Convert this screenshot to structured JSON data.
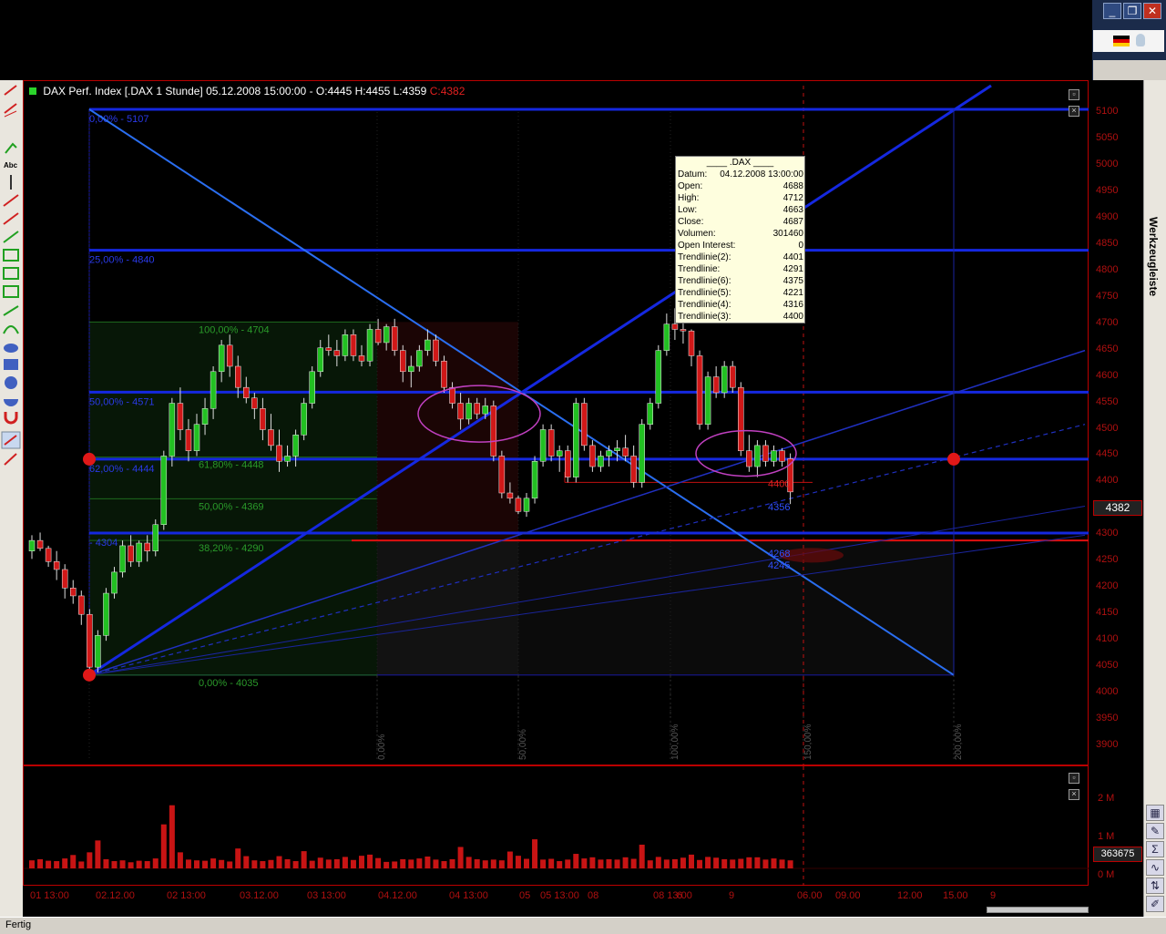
{
  "chart": {
    "instrument": "DAX Perf. Index [.DAX  1 Stunde]",
    "date": "05.12.2008 15:00:00",
    "ohlc_text": "- O:4445 H:4455 L:4359",
    "close_text": "C:4382",
    "last_price": "4382",
    "volume_tag": "363675"
  },
  "tooltip": {
    "header": "____ .DAX ____",
    "rows": [
      {
        "label": "Datum:",
        "value": "04.12.2008 13:00:00"
      },
      {
        "label": "Open:",
        "value": "4688"
      },
      {
        "label": "High:",
        "value": "4712"
      },
      {
        "label": "Low:",
        "value": "4663"
      },
      {
        "label": "Close:",
        "value": "4687"
      },
      {
        "label": "Volumen:",
        "value": "301460"
      },
      {
        "label": "Open Interest:",
        "value": "0"
      },
      {
        "label": "Trendlinie(2):",
        "value": "4401"
      },
      {
        "label": "Trendlinie:",
        "value": "4291"
      },
      {
        "label": "Trendlinie(6):",
        "value": "4375"
      },
      {
        "label": "Trendlinie(5):",
        "value": "4221"
      },
      {
        "label": "Trendlinie(4):",
        "value": "4316"
      },
      {
        "label": "Trendlinie(3):",
        "value": "4400"
      }
    ]
  },
  "fib_blue": [
    {
      "text": "0,00% - 5107",
      "price": 5107
    },
    {
      "text": "25,00% - 4840",
      "price": 4840
    },
    {
      "text": "50,00% - 4571",
      "price": 4571
    },
    {
      "text": "62,00% - 4444",
      "price": 4444
    },
    {
      "text": "- 4304",
      "price": 4304
    }
  ],
  "fib_green": [
    {
      "text": "100,00% - 4704",
      "price": 4704
    },
    {
      "text": "61,80% - 4448",
      "price": 4448
    },
    {
      "text": "50,00% - 4369",
      "price": 4369
    },
    {
      "text": "38,20% - 4290",
      "price": 4290
    },
    {
      "text": "0,00% - 4035",
      "price": 4035
    }
  ],
  "level_labels": [
    {
      "text": "4400",
      "price": 4400,
      "color": "#e02020"
    },
    {
      "text": "4356",
      "price": 4356,
      "color": "#3050ff"
    },
    {
      "text": "4268",
      "price": 4268,
      "color": "#3050ff"
    },
    {
      "text": "4245",
      "price": 4245,
      "color": "#3050ff"
    }
  ],
  "time_pct_labels": [
    "0,00%",
    "50,00%",
    "100,00%",
    "150,00%",
    "200,00%"
  ],
  "y_ticks": [
    "5100",
    "5050",
    "5000",
    "4950",
    "4900",
    "4850",
    "4800",
    "4750",
    "4700",
    "4650",
    "4600",
    "4550",
    "4500",
    "4450",
    "4400",
    "4350",
    "4300",
    "4250",
    "4200",
    "4150",
    "4100",
    "4050",
    "4000",
    "3950",
    "3900"
  ],
  "vol_ticks": [
    "2 M",
    "1 M",
    "0 M"
  ],
  "x_ticks": [
    "01 13:00",
    "02.12.00",
    "02 13:00",
    "03.12.00",
    "03 13:00",
    "04.12.00",
    "04 13:00",
    "05",
    "05 13:00",
    "08",
    "08 13:00",
    "6",
    "9",
    "06.00",
    "09.00",
    "12.00",
    "15.00",
    "9"
  ],
  "status": "Fertig",
  "sidebar_label": "Werkzeugleiste",
  "chart_data": {
    "type": "candlestick",
    "ylim": [
      3880,
      5130
    ],
    "candles": [
      [
        4270,
        4300,
        4255,
        4290
      ],
      [
        4290,
        4305,
        4270,
        4275
      ],
      [
        4275,
        4280,
        4240,
        4250
      ],
      [
        4250,
        4270,
        4215,
        4235
      ],
      [
        4235,
        4245,
        4180,
        4200
      ],
      [
        4200,
        4215,
        4170,
        4185
      ],
      [
        4185,
        4195,
        4130,
        4150
      ],
      [
        4150,
        4160,
        4040,
        4050
      ],
      [
        4050,
        4120,
        4040,
        4110
      ],
      [
        4110,
        4200,
        4100,
        4190
      ],
      [
        4190,
        4240,
        4180,
        4230
      ],
      [
        4230,
        4290,
        4220,
        4280
      ],
      [
        4280,
        4300,
        4240,
        4250
      ],
      [
        4250,
        4290,
        4240,
        4285
      ],
      [
        4285,
        4300,
        4250,
        4270
      ],
      [
        4270,
        4330,
        4260,
        4320
      ],
      [
        4320,
        4460,
        4310,
        4450
      ],
      [
        4450,
        4560,
        4430,
        4550
      ],
      [
        4550,
        4580,
        4480,
        4500
      ],
      [
        4500,
        4520,
        4440,
        4460
      ],
      [
        4460,
        4530,
        4450,
        4510
      ],
      [
        4510,
        4560,
        4490,
        4540
      ],
      [
        4540,
        4620,
        4520,
        4610
      ],
      [
        4610,
        4670,
        4590,
        4660
      ],
      [
        4660,
        4680,
        4600,
        4620
      ],
      [
        4620,
        4640,
        4560,
        4580
      ],
      [
        4580,
        4600,
        4550,
        4560
      ],
      [
        4560,
        4570,
        4520,
        4540
      ],
      [
        4540,
        4560,
        4480,
        4500
      ],
      [
        4500,
        4530,
        4460,
        4470
      ],
      [
        4470,
        4500,
        4420,
        4440
      ],
      [
        4440,
        4470,
        4430,
        4450
      ],
      [
        4450,
        4500,
        4430,
        4490
      ],
      [
        4490,
        4560,
        4480,
        4550
      ],
      [
        4550,
        4620,
        4540,
        4610
      ],
      [
        4610,
        4670,
        4600,
        4655
      ],
      [
        4655,
        4680,
        4640,
        4650
      ],
      [
        4650,
        4670,
        4620,
        4640
      ],
      [
        4640,
        4690,
        4630,
        4680
      ],
      [
        4680,
        4690,
        4630,
        4640
      ],
      [
        4640,
        4660,
        4620,
        4630
      ],
      [
        4630,
        4700,
        4620,
        4690
      ],
      [
        4690,
        4710,
        4660,
        4665
      ],
      [
        4665,
        4700,
        4650,
        4695
      ],
      [
        4695,
        4710,
        4640,
        4650
      ],
      [
        4650,
        4660,
        4590,
        4610
      ],
      [
        4610,
        4640,
        4580,
        4620
      ],
      [
        4620,
        4660,
        4610,
        4650
      ],
      [
        4650,
        4690,
        4640,
        4670
      ],
      [
        4670,
        4680,
        4620,
        4630
      ],
      [
        4630,
        4640,
        4570,
        4580
      ],
      [
        4580,
        4590,
        4540,
        4550
      ],
      [
        4550,
        4570,
        4500,
        4520
      ],
      [
        4520,
        4560,
        4510,
        4550
      ],
      [
        4550,
        4560,
        4520,
        4530
      ],
      [
        4530,
        4560,
        4520,
        4545
      ],
      [
        4545,
        4555,
        4440,
        4450
      ],
      [
        4450,
        4460,
        4370,
        4380
      ],
      [
        4380,
        4400,
        4360,
        4370
      ],
      [
        4370,
        4375,
        4340,
        4345
      ],
      [
        4345,
        4380,
        4335,
        4370
      ],
      [
        4370,
        4450,
        4360,
        4440
      ],
      [
        4440,
        4510,
        4430,
        4500
      ],
      [
        4500,
        4510,
        4440,
        4450
      ],
      [
        4450,
        4470,
        4420,
        4460
      ],
      [
        4460,
        4470,
        4400,
        4410
      ],
      [
        4410,
        4560,
        4400,
        4550
      ],
      [
        4550,
        4560,
        4460,
        4470
      ],
      [
        4470,
        4480,
        4420,
        4430
      ],
      [
        4430,
        4460,
        4420,
        4450
      ],
      [
        4450,
        4470,
        4430,
        4460
      ],
      [
        4460,
        4480,
        4440,
        4465
      ],
      [
        4465,
        4490,
        4440,
        4450
      ],
      [
        4450,
        4470,
        4390,
        4400
      ],
      [
        4400,
        4520,
        4390,
        4510
      ],
      [
        4510,
        4560,
        4500,
        4550
      ],
      [
        4550,
        4660,
        4540,
        4650
      ],
      [
        4650,
        4720,
        4640,
        4700
      ],
      [
        4700,
        4730,
        4670,
        4690
      ],
      [
        4690,
        4712,
        4663,
        4687
      ],
      [
        4687,
        4690,
        4620,
        4640
      ],
      [
        4640,
        4650,
        4500,
        4510
      ],
      [
        4510,
        4610,
        4500,
        4600
      ],
      [
        4600,
        4620,
        4560,
        4570
      ],
      [
        4570,
        4630,
        4560,
        4620
      ],
      [
        4620,
        4630,
        4570,
        4580
      ],
      [
        4580,
        4590,
        4450,
        4460
      ],
      [
        4460,
        4490,
        4420,
        4430
      ],
      [
        4430,
        4480,
        4410,
        4470
      ],
      [
        4470,
        4480,
        4430,
        4440
      ],
      [
        4440,
        4470,
        4430,
        4460
      ],
      [
        4460,
        4465,
        4430,
        4440
      ],
      [
        4445,
        4455,
        4359,
        4382
      ]
    ],
    "volume_max": 2000000,
    "volume": [
      210000,
      240000,
      200000,
      190000,
      260000,
      350000,
      180000,
      420000,
      730000,
      240000,
      190000,
      210000,
      160000,
      200000,
      190000,
      260000,
      1150000,
      1650000,
      420000,
      230000,
      210000,
      200000,
      260000,
      220000,
      180000,
      520000,
      320000,
      210000,
      190000,
      220000,
      320000,
      240000,
      190000,
      450000,
      200000,
      280000,
      230000,
      240000,
      300000,
      220000,
      330000,
      360000,
      270000,
      170000,
      180000,
      240000,
      230000,
      260000,
      310000,
      230000,
      190000,
      240000,
      560000,
      300000,
      240000,
      210000,
      230000,
      210000,
      440000,
      330000,
      250000,
      760000,
      230000,
      250000,
      190000,
      230000,
      380000,
      260000,
      290000,
      230000,
      240000,
      230000,
      290000,
      250000,
      620000,
      210000,
      300000,
      230000,
      240000,
      280000,
      360000,
      220000,
      300000,
      280000,
      240000,
      230000,
      250000,
      290000,
      290000,
      230000,
      260000,
      230000,
      210000
    ]
  }
}
